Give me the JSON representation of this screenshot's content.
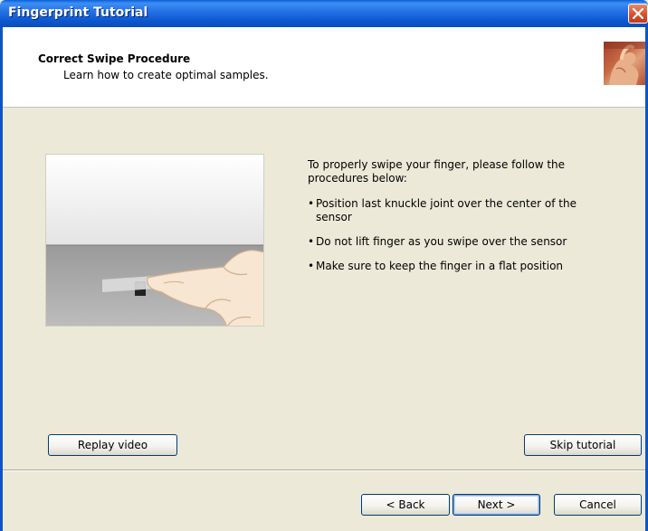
{
  "window": {
    "title": "Fingerprint Tutorial"
  },
  "header": {
    "title": "Correct Swipe Procedure",
    "subtitle": "Learn how to create optimal samples."
  },
  "instructions": {
    "intro": "To properly swipe your finger, please follow the procedures below:",
    "bullets": [
      "Position last knuckle joint over the center of the sensor",
      "Do not lift finger as you swipe over the sensor",
      "Make sure to keep the finger in a flat position"
    ]
  },
  "buttons": {
    "replay": "Replay video",
    "skip": "Skip tutorial",
    "back": "< Back",
    "next": "Next >",
    "cancel": "Cancel"
  },
  "icons": {
    "close": "close-icon",
    "header_image": "finger-photo-icon",
    "illustration": "finger-swipe-illustration"
  },
  "colors": {
    "titlebar": "#0a5fd6",
    "close_button": "#d9512b",
    "dialog_background": "#ece9d8",
    "header_background": "#ffffff",
    "button_border": "#003c74"
  }
}
